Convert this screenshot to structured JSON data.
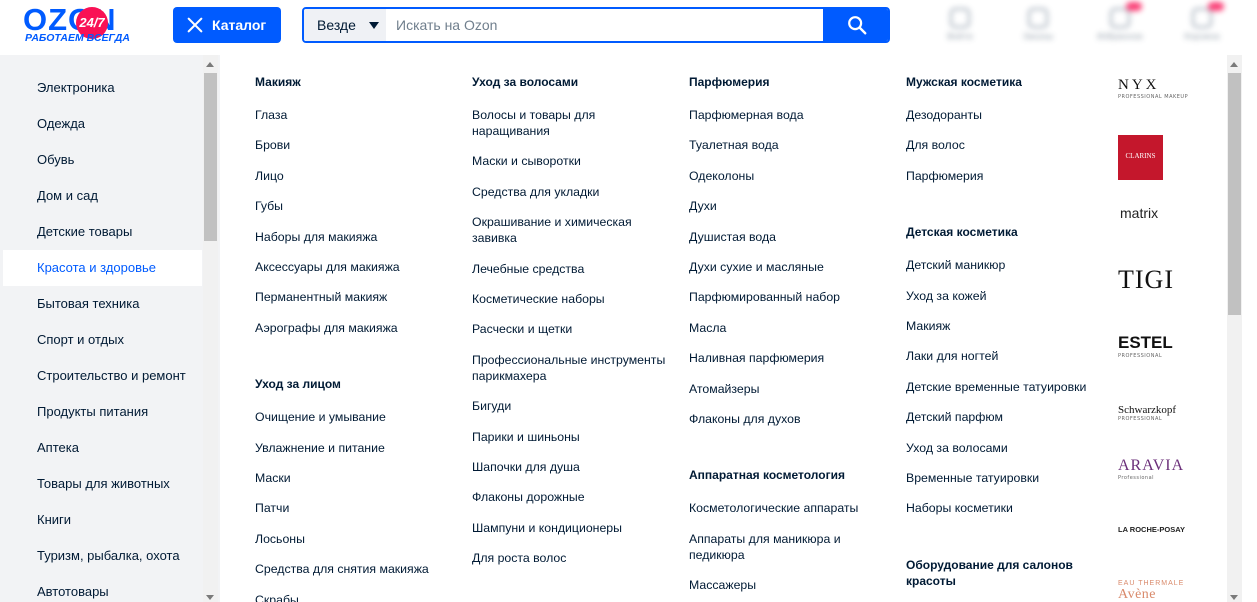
{
  "header": {
    "logo_word": "OZON",
    "logo_badge": "24/7",
    "logo_sub": "РАБОТАЕМ ВСЕГДА",
    "catalog_label": "Каталог",
    "search_scope": "Везде",
    "search_placeholder": "Искать на Ozon",
    "nav": [
      "Войти",
      "Заказы",
      "Избранное",
      "Корзина"
    ]
  },
  "colors": {
    "brand": "#005bff",
    "accent": "#f91155",
    "sidebar_bg": "#f2f3f5"
  },
  "sidebar": {
    "items": [
      "Электроника",
      "Одежда",
      "Обувь",
      "Дом и сад",
      "Детские товары",
      "Красота и здоровье",
      "Бытовая техника",
      "Спорт и отдых",
      "Строительство и ремонт",
      "Продукты питания",
      "Аптека",
      "Товары для животных",
      "Книги",
      "Туризм, рыбалка, охота",
      "Автотовары"
    ],
    "active_index": 5
  },
  "columns": [
    {
      "groups": [
        {
          "title": "Макияж",
          "links": [
            "Глаза",
            "Брови",
            "Лицо",
            "Губы",
            "Наборы для макияжа",
            "Аксессуары для макияжа",
            "Перманентный макияж",
            "Аэрографы для макияжа"
          ]
        },
        {
          "title": "Уход за лицом",
          "links": [
            "Очищение и умывание",
            "Увлажнение и питание",
            "Маски",
            "Патчи",
            "Лосьоны",
            "Средства для снятия макияжа",
            "Скрабы"
          ]
        }
      ]
    },
    {
      "groups": [
        {
          "title": "Уход за волосами",
          "links": [
            "Волосы и товары для наращивания",
            "Маски и сыворотки",
            "Средства для укладки",
            "Окрашивание и химическая завивка",
            "Лечебные средства",
            "Косметические наборы",
            "Расчески и щетки",
            "Профессиональные инструменты парикмахера",
            "Бигуди",
            "Парики и шиньоны",
            "Шапочки для душа",
            "Флаконы дорожные",
            "Шампуни и кондиционеры",
            "Для роста волос"
          ]
        }
      ]
    },
    {
      "groups": [
        {
          "title": "Парфюмерия",
          "links": [
            "Парфюмерная вода",
            "Туалетная вода",
            "Одеколоны",
            "Духи",
            "Душистая вода",
            "Духи сухие и масляные",
            "Парфюмированный набор",
            "Масла",
            "Наливная парфюмерия",
            "Атомайзеры",
            "Флаконы для духов"
          ]
        },
        {
          "title": "Аппаратная косметология",
          "links": [
            "Косметологические аппараты",
            "Аппараты для маникюра и педикюра",
            "Массажеры"
          ]
        }
      ]
    },
    {
      "groups": [
        {
          "title": "Мужская косметика",
          "links": [
            "Дезодоранты",
            "Для волос",
            "Парфюмерия"
          ]
        },
        {
          "title": "Детская косметика",
          "links": [
            "Детский маникюр",
            "Уход за кожей",
            "Макияж",
            "Лаки для ногтей",
            "Детские временные татуировки",
            "Детский парфюм",
            "Уход за волосами",
            "Временные татуировки",
            "Наборы косметики"
          ]
        },
        {
          "title": "Оборудование для салонов красоты",
          "links": []
        }
      ]
    }
  ],
  "brands": [
    {
      "name": "NYX",
      "sub": "PROFESSIONAL MAKEUP"
    },
    {
      "name": "CLARINS",
      "sub": ""
    },
    {
      "name": "matrix",
      "sub": ""
    },
    {
      "name": "TIGI",
      "sub": ""
    },
    {
      "name": "ESTEL",
      "sub": "PROFESSIONAL"
    },
    {
      "name": "Schwarzkopf",
      "sub": "PROFESSIONAL"
    },
    {
      "name": "ARAVIA",
      "sub": "Professional"
    },
    {
      "name": "LA ROCHE-POSAY",
      "sub": ""
    },
    {
      "name": "EAU THERMALE",
      "sub": "Avène"
    }
  ]
}
